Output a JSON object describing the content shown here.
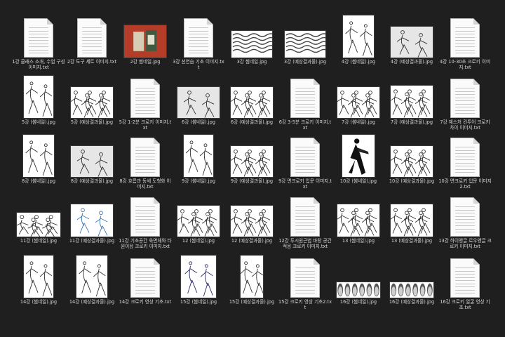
{
  "files": [
    {
      "label": "1강 클래스 소개, 수업 구성 이미지.txt",
      "kind": "text"
    },
    {
      "label": "2강 도구 세트 이미지.txt",
      "kind": "text"
    },
    {
      "label": "2강 썸네일.jpg",
      "kind": "image",
      "style": "books"
    },
    {
      "label": "3강 선연습 기초 이미지.txt",
      "kind": "text"
    },
    {
      "label": "3강 썸네일.jpg",
      "kind": "image",
      "style": "waves"
    },
    {
      "label": "3강 (예상결과물).jpg",
      "kind": "image",
      "style": "waves"
    },
    {
      "label": "4강 (썸네일).jpg",
      "kind": "image",
      "style": "tall-sketch"
    },
    {
      "label": "4강 (예상결과물).jpg",
      "kind": "image",
      "style": "gray-sketch"
    },
    {
      "label": "4강 10-30초 크로키 이미지.txt",
      "kind": "text"
    },
    {
      "label": "5강 (썸네일).jpg",
      "kind": "image",
      "style": "tall-figure"
    },
    {
      "label": "5강 (예상결과물).jpg",
      "kind": "image",
      "style": "wide-figures"
    },
    {
      "label": "5강 1-2분 크로키 이미지.txt",
      "kind": "text"
    },
    {
      "label": "6강 (썸네일).jpg",
      "kind": "image",
      "style": "gray-sketch"
    },
    {
      "label": "6강 (예상결과물).jpg",
      "kind": "image",
      "style": "wide-figures"
    },
    {
      "label": "6강 3-5분 크로키 이미지.txt",
      "kind": "text"
    },
    {
      "label": "7강 (썸네일).jpg",
      "kind": "image",
      "style": "wide-figures"
    },
    {
      "label": "7강 (예상결과물).jpg",
      "kind": "image",
      "style": "wide-sketch"
    },
    {
      "label": "7강 제스처 컨투어 크로키 차이 이미지.txt",
      "kind": "text"
    },
    {
      "label": "8강 (썸네일).jpg",
      "kind": "image",
      "style": "tall-sketch"
    },
    {
      "label": "8강 (예상결과물).jpg",
      "kind": "image",
      "style": "gray-sketch"
    },
    {
      "label": "8강 흐름과 동세 도형화 이미지.txt",
      "kind": "text"
    },
    {
      "label": "9강 (썸네일).jpg",
      "kind": "image",
      "style": "tall-figure"
    },
    {
      "label": "9강 (예상결과물).jpg",
      "kind": "image",
      "style": "wide-figures"
    },
    {
      "label": "9강 면크로키 입문 이미지.txt",
      "kind": "text"
    },
    {
      "label": "10강 (썸네일).jpg",
      "kind": "image",
      "style": "dark-figure"
    },
    {
      "label": "10강 (예상결과물).jpg",
      "kind": "image",
      "style": "wide-figures"
    },
    {
      "label": "10강 면크로키 입문 이미지2.txt",
      "kind": "text"
    },
    {
      "label": "11강 (썸네일).jpg",
      "kind": "image",
      "style": "strip"
    },
    {
      "label": "11강 (예상결과물).jpg",
      "kind": "image",
      "style": "blue-sketch"
    },
    {
      "label": "11강 기초공간 육면체와 타원이용 크로키 이미지.txt",
      "kind": "text"
    },
    {
      "label": "12 (썸네일).jpg",
      "kind": "image",
      "style": "wide-figures"
    },
    {
      "label": "12 (예상결과물).jpg",
      "kind": "image",
      "style": "wide-figures"
    },
    {
      "label": "12강 투시원근법 바탕 공간 적용 크로키 이미지.txt",
      "kind": "text"
    },
    {
      "label": "13 (썸네일).jpg",
      "kind": "image",
      "style": "wide-sketch"
    },
    {
      "label": "13 (예상결과물).jpg",
      "kind": "image",
      "style": "wide-sketch"
    },
    {
      "label": "13강 하이앵글 로우앵글 크로키 이미지.txt",
      "kind": "text"
    },
    {
      "label": "14강 (썸네일).jpg",
      "kind": "image",
      "style": "tall-figure"
    },
    {
      "label": "14강 (예상결과물).jpg",
      "kind": "image",
      "style": "tall-sketch"
    },
    {
      "label": "14강 크로키 영상 기초.txt",
      "kind": "text"
    },
    {
      "label": "15강 (썸네일).jpg",
      "kind": "image",
      "style": "ink-figure"
    },
    {
      "label": "15강 (예상결과물).jpg",
      "kind": "image",
      "style": "narrow-figure"
    },
    {
      "label": "15강 크로키 영상 기초2.txt",
      "kind": "text"
    },
    {
      "label": "16강 (썸네일).jpg",
      "kind": "image",
      "style": "faces"
    },
    {
      "label": "16강 (예상결과물).jpg",
      "kind": "image",
      "style": "faces"
    },
    {
      "label": "16강 크로키 얼굴 영상 기초.txt",
      "kind": "text"
    }
  ]
}
